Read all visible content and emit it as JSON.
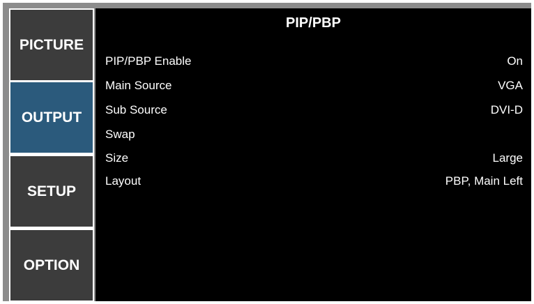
{
  "menu": {
    "tabs": [
      {
        "label": "PICTURE"
      },
      {
        "label": "OUTPUT"
      },
      {
        "label": "SETUP"
      },
      {
        "label": "OPTION"
      }
    ],
    "active_tab": "OUTPUT"
  },
  "panel": {
    "title": "PIP/PBP",
    "rows": [
      {
        "label": "PIP/PBP Enable",
        "value": "On"
      },
      {
        "label": "Main Source",
        "value": "VGA"
      },
      {
        "label": "Sub Source",
        "value": "DVI-D"
      },
      {
        "label": "Swap",
        "value": ""
      },
      {
        "label": "Size",
        "value": "Large"
      },
      {
        "label": "Layout",
        "value": "PBP, Main Left"
      }
    ]
  },
  "colors": {
    "frame": "#8c8c8c",
    "tab_bg": "#3c3c3c",
    "tab_active_bg": "#2b5a7c",
    "panel_bg": "#000000",
    "text": "#ffffff"
  }
}
